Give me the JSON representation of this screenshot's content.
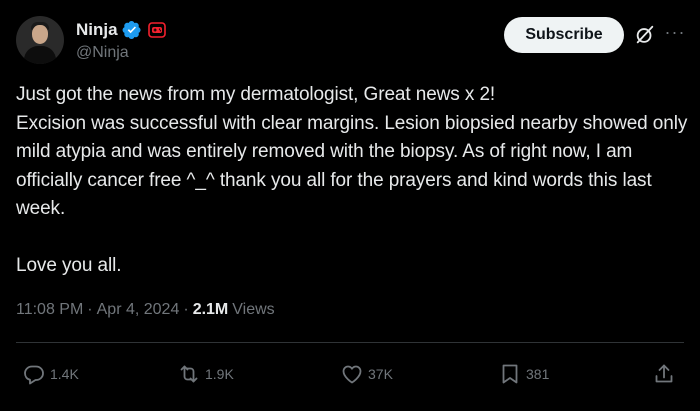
{
  "author": {
    "display_name": "Ninja",
    "handle": "@Ninja"
  },
  "header": {
    "subscribe_label": "Subscribe",
    "more_icon": "more-icon",
    "grok_icon": "grok-icon",
    "colors": {
      "verified": "#1d9bf0",
      "game_badge": "#f4212e"
    }
  },
  "tweet": {
    "text": "Just got the news from my dermatologist, Great news x 2!\nExcision was successful with clear margins.  Lesion biopsied nearby showed only mild atypia and was entirely removed with the biopsy. As of right now, I am officially cancer free ^_^ thank you all for the prayers and kind words this last week.\n\nLove you all.",
    "time": "11:08 PM",
    "date": "Apr 4, 2024",
    "views_count": "2.1M",
    "views_label": "Views"
  },
  "actions": {
    "replies": "1.4K",
    "reposts": "1.9K",
    "likes": "37K",
    "bookmarks": "381"
  }
}
